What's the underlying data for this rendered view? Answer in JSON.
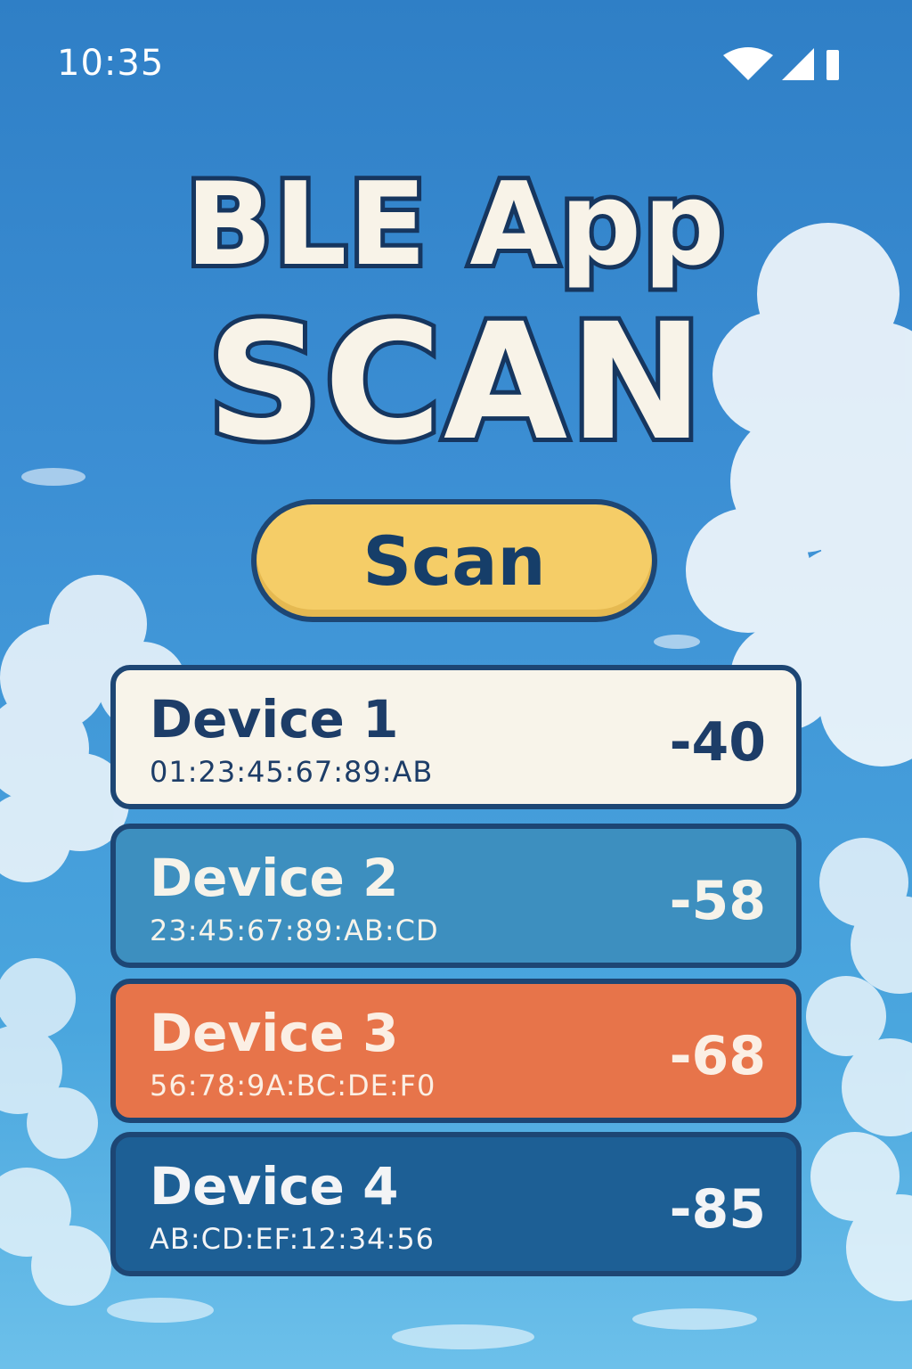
{
  "status_bar": {
    "time": "10:35",
    "icons": [
      "wifi-icon",
      "cellular-signal-icon",
      "battery-icon"
    ]
  },
  "title": {
    "line1": "BLE App",
    "line2": "SCAN"
  },
  "scan_button": {
    "label": "Scan",
    "color": "#f5cd67"
  },
  "devices": [
    {
      "name": "Device 1",
      "mac": "01:23:45:67:89:AB",
      "rssi": "-40",
      "color": "#f8f4ea"
    },
    {
      "name": "Device 2",
      "mac": "23:45:67:89:AB:CD",
      "rssi": "-58",
      "color": "#3d8fbf"
    },
    {
      "name": "Device 3",
      "mac": "56:78:9A:BC:DE:F0",
      "rssi": "-68",
      "color": "#e7744a"
    },
    {
      "name": "Device 4",
      "mac": "AB:CD:EF:12:34:56",
      "rssi": "-85",
      "color": "#1d5f95"
    }
  ],
  "colors": {
    "sky": "#3c8fd4",
    "outline": "#1d4674",
    "title_fill": "#f8f3e8"
  }
}
